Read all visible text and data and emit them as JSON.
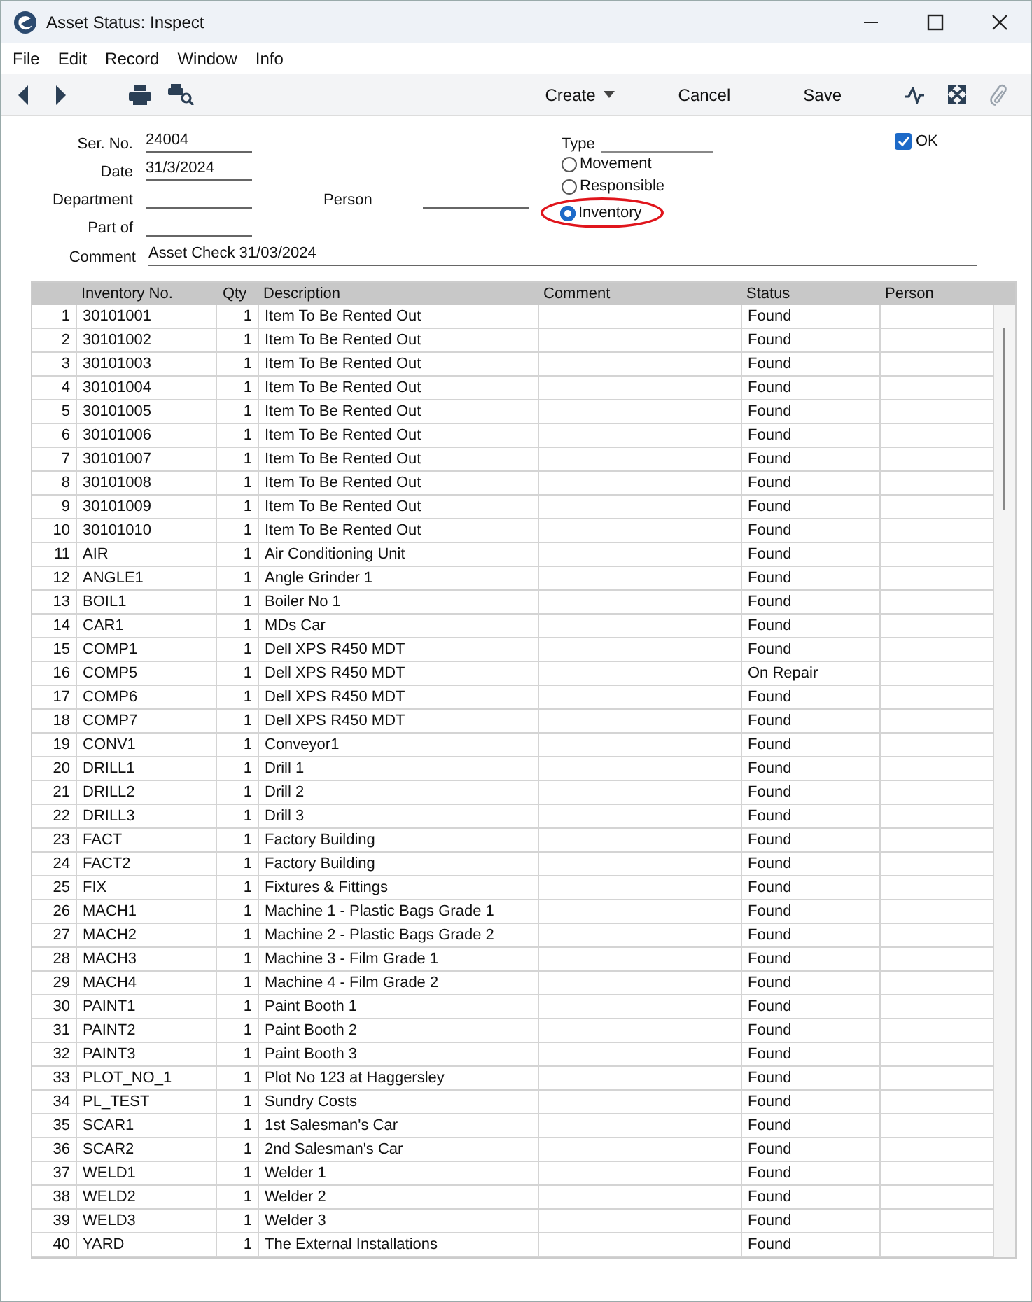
{
  "window": {
    "title": "Asset Status: Inspect"
  },
  "menu": [
    "File",
    "Edit",
    "Record",
    "Window",
    "Info"
  ],
  "toolbar": {
    "buttons": [
      {
        "label": "Create",
        "kind": "dropdown"
      },
      {
        "label": "Cancel",
        "kind": "plain"
      },
      {
        "label": "Save",
        "kind": "plain"
      }
    ]
  },
  "form": {
    "ser_no": {
      "label": "Ser. No.",
      "value": "24004"
    },
    "date": {
      "label": "Date",
      "value": "31/3/2024"
    },
    "department": {
      "label": "Department"
    },
    "person": {
      "label": "Person"
    },
    "part_of": {
      "label": "Part of"
    },
    "comment": {
      "label": "Comment",
      "value": "Asset Check 31/03/2024"
    },
    "type": {
      "label": "Type",
      "options": [
        {
          "label": "Movement",
          "selected": false,
          "circled": false
        },
        {
          "label": "Responsible",
          "selected": false,
          "circled": false
        },
        {
          "label": "Inventory",
          "selected": true,
          "circled": true
        }
      ]
    },
    "ok": {
      "label": "OK",
      "checked": true
    }
  },
  "table": {
    "columns": [
      "Inventory No.",
      "Qty",
      "Description",
      "Comment",
      "Status",
      "Person"
    ],
    "rows": [
      {
        "row": "1",
        "inventory_no": "30101001",
        "qty": "1",
        "description": "Item To Be Rented Out",
        "status": "Found"
      },
      {
        "row": "2",
        "inventory_no": "30101002",
        "qty": "1",
        "description": "Item To Be Rented Out",
        "status": "Found"
      },
      {
        "row": "3",
        "inventory_no": "30101003",
        "qty": "1",
        "description": "Item To Be Rented Out",
        "status": "Found"
      },
      {
        "row": "4",
        "inventory_no": "30101004",
        "qty": "1",
        "description": "Item To Be Rented Out",
        "status": "Found"
      },
      {
        "row": "5",
        "inventory_no": "30101005",
        "qty": "1",
        "description": "Item To Be Rented Out",
        "status": "Found"
      },
      {
        "row": "6",
        "inventory_no": "30101006",
        "qty": "1",
        "description": "Item To Be Rented Out",
        "status": "Found"
      },
      {
        "row": "7",
        "inventory_no": "30101007",
        "qty": "1",
        "description": "Item To Be Rented Out",
        "status": "Found"
      },
      {
        "row": "8",
        "inventory_no": "30101008",
        "qty": "1",
        "description": "Item To Be Rented Out",
        "status": "Found"
      },
      {
        "row": "9",
        "inventory_no": "30101009",
        "qty": "1",
        "description": "Item To Be Rented Out",
        "status": "Found"
      },
      {
        "row": "10",
        "inventory_no": "30101010",
        "qty": "1",
        "description": "Item To Be Rented Out",
        "status": "Found"
      },
      {
        "row": "11",
        "inventory_no": "AIR",
        "qty": "1",
        "description": "Air Conditioning Unit",
        "status": "Found"
      },
      {
        "row": "12",
        "inventory_no": "ANGLE1",
        "qty": "1",
        "description": "Angle Grinder 1",
        "status": "Found"
      },
      {
        "row": "13",
        "inventory_no": "BOIL1",
        "qty": "1",
        "description": "Boiler No 1",
        "status": "Found"
      },
      {
        "row": "14",
        "inventory_no": "CAR1",
        "qty": "1",
        "description": "MDs Car",
        "status": "Found"
      },
      {
        "row": "15",
        "inventory_no": "COMP1",
        "qty": "1",
        "description": "Dell XPS R450 MDT",
        "status": "Found"
      },
      {
        "row": "16",
        "inventory_no": "COMP5",
        "qty": "1",
        "description": "Dell XPS R450 MDT",
        "status": "On Repair"
      },
      {
        "row": "17",
        "inventory_no": "COMP6",
        "qty": "1",
        "description": "Dell XPS R450 MDT",
        "status": "Found"
      },
      {
        "row": "18",
        "inventory_no": "COMP7",
        "qty": "1",
        "description": "Dell XPS R450 MDT",
        "status": "Found"
      },
      {
        "row": "19",
        "inventory_no": "CONV1",
        "qty": "1",
        "description": "Conveyor1",
        "status": "Found"
      },
      {
        "row": "20",
        "inventory_no": "DRILL1",
        "qty": "1",
        "description": "Drill 1",
        "status": "Found"
      },
      {
        "row": "21",
        "inventory_no": "DRILL2",
        "qty": "1",
        "description": "Drill 2",
        "status": "Found"
      },
      {
        "row": "22",
        "inventory_no": "DRILL3",
        "qty": "1",
        "description": "Drill 3",
        "status": "Found"
      },
      {
        "row": "23",
        "inventory_no": "FACT",
        "qty": "1",
        "description": "Factory Building",
        "status": "Found"
      },
      {
        "row": "24",
        "inventory_no": "FACT2",
        "qty": "1",
        "description": "Factory Building",
        "status": "Found"
      },
      {
        "row": "25",
        "inventory_no": "FIX",
        "qty": "1",
        "description": "Fixtures & Fittings",
        "status": "Found"
      },
      {
        "row": "26",
        "inventory_no": "MACH1",
        "qty": "1",
        "description": "Machine 1 - Plastic Bags Grade 1",
        "status": "Found"
      },
      {
        "row": "27",
        "inventory_no": "MACH2",
        "qty": "1",
        "description": "Machine 2 - Plastic Bags Grade 2",
        "status": "Found"
      },
      {
        "row": "28",
        "inventory_no": "MACH3",
        "qty": "1",
        "description": "Machine 3 - Film Grade 1",
        "status": "Found"
      },
      {
        "row": "29",
        "inventory_no": "MACH4",
        "qty": "1",
        "description": "Machine 4 - Film Grade 2",
        "status": "Found"
      },
      {
        "row": "30",
        "inventory_no": "PAINT1",
        "qty": "1",
        "description": "Paint Booth 1",
        "status": "Found"
      },
      {
        "row": "31",
        "inventory_no": "PAINT2",
        "qty": "1",
        "description": "Paint Booth 2",
        "status": "Found"
      },
      {
        "row": "32",
        "inventory_no": "PAINT3",
        "qty": "1",
        "description": "Paint Booth 3",
        "status": "Found"
      },
      {
        "row": "33",
        "inventory_no": "PLOT_NO_1",
        "qty": "1",
        "description": "Plot No 123 at Haggersley",
        "status": "Found"
      },
      {
        "row": "34",
        "inventory_no": "PL_TEST",
        "qty": "1",
        "description": "Sundry Costs",
        "status": "Found"
      },
      {
        "row": "35",
        "inventory_no": "SCAR1",
        "qty": "1",
        "description": "1st Salesman's Car",
        "status": "Found"
      },
      {
        "row": "36",
        "inventory_no": "SCAR2",
        "qty": "1",
        "description": "2nd Salesman's Car",
        "status": "Found"
      },
      {
        "row": "37",
        "inventory_no": "WELD1",
        "qty": "1",
        "description": "Welder 1",
        "status": "Found"
      },
      {
        "row": "38",
        "inventory_no": "WELD2",
        "qty": "1",
        "description": "Welder 2",
        "status": "Found"
      },
      {
        "row": "39",
        "inventory_no": "WELD3",
        "qty": "1",
        "description": "Welder 3",
        "status": "Found"
      },
      {
        "row": "40",
        "inventory_no": "YARD",
        "qty": "1",
        "description": "The External Installations",
        "status": "Found"
      }
    ]
  }
}
